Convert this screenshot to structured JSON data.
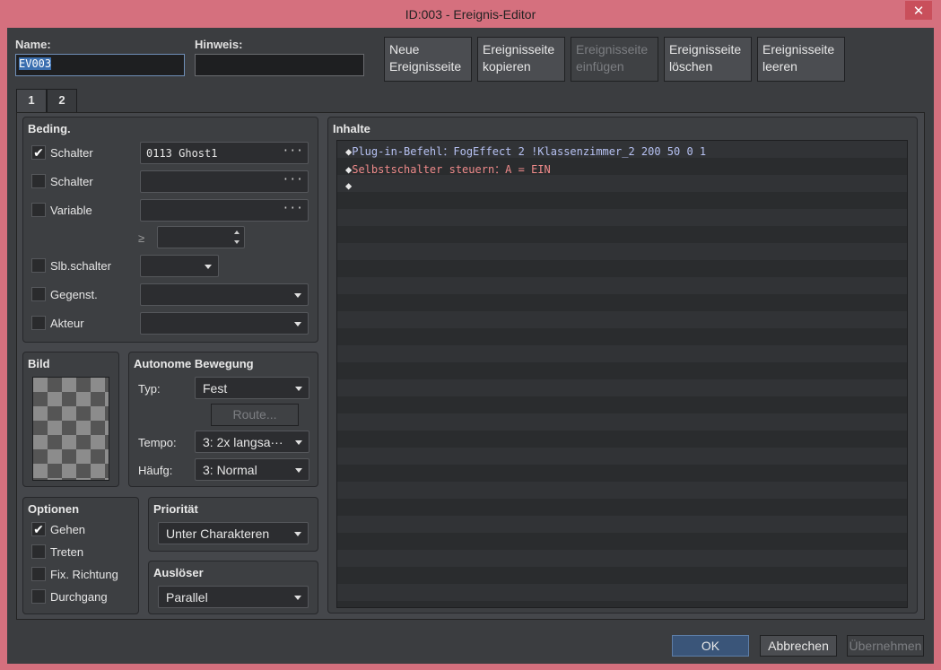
{
  "window": {
    "title": "ID:003 - Ereignis-Editor",
    "close_glyph": "✕"
  },
  "header": {
    "name_label": "Name:",
    "name_value": "EV003",
    "note_label": "Hinweis:",
    "note_value": ""
  },
  "page_buttons": {
    "new": "Neue Ereignisseite",
    "copy": "Ereignisseite kopieren",
    "paste": "Ereignisseite einfügen",
    "delete": "Ereignisseite löschen",
    "clear": "Ereignisseite leeren"
  },
  "tabs": [
    "1",
    "2"
  ],
  "conditions": {
    "title": "Beding.",
    "switch1": {
      "label": "Schalter",
      "checked": true,
      "value": "0113 Ghost1"
    },
    "switch2": {
      "label": "Schalter",
      "checked": false,
      "value": ""
    },
    "variable": {
      "label": "Variable",
      "checked": false,
      "value": ""
    },
    "variable_op": "≥",
    "variable_num": "",
    "self_switch": {
      "label": "Slb.schalter",
      "checked": false,
      "value": ""
    },
    "item": {
      "label": "Gegenst.",
      "checked": false,
      "value": ""
    },
    "actor": {
      "label": "Akteur",
      "checked": false,
      "value": ""
    },
    "ellipsis": "···"
  },
  "image": {
    "title": "Bild"
  },
  "autonomous": {
    "title": "Autonome Bewegung",
    "type_label": "Typ:",
    "type_value": "Fest",
    "route_label": "Route...",
    "speed_label": "Tempo:",
    "speed_value": "3: 2x langsa···",
    "freq_label": "Häufg:",
    "freq_value": "3: Normal"
  },
  "options": {
    "title": "Optionen",
    "items": [
      {
        "label": "Gehen",
        "checked": true
      },
      {
        "label": "Treten",
        "checked": false
      },
      {
        "label": "Fix. Richtung",
        "checked": false
      },
      {
        "label": "Durchgang",
        "checked": false
      }
    ]
  },
  "priority": {
    "title": "Priorität",
    "value": "Unter Charakteren"
  },
  "trigger": {
    "title": "Auslöser",
    "value": "Parallel"
  },
  "contents": {
    "title": "Inhalte",
    "lines": [
      {
        "marker": "◆",
        "text": "Plug-in-Befehl：FogEffect 2 !Klassenzimmer_2 200 50 0 1",
        "kind": "plugin"
      },
      {
        "marker": "◆",
        "text": "Selbstschalter steuern：A = EIN",
        "kind": "self"
      },
      {
        "marker": "◆",
        "text": "",
        "kind": "empty"
      }
    ]
  },
  "footer": {
    "ok": "OK",
    "cancel": "Abbrechen",
    "apply": "Übernehmen"
  },
  "colors": {
    "accent": "#3a5579",
    "titlebar": "#d5707e",
    "plugin_text": "#b6c1f2",
    "self_switch_text": "#ee8a8a"
  }
}
